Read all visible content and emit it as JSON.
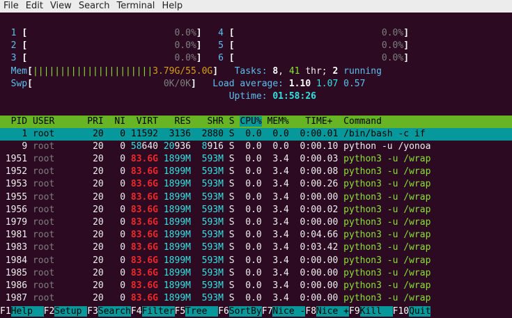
{
  "menu": [
    "File",
    "Edit",
    "View",
    "Search",
    "Terminal",
    "Help"
  ],
  "cpus": [
    {
      "num": "1",
      "value": "0.0%"
    },
    {
      "num": "2",
      "value": "0.0%"
    },
    {
      "num": "3",
      "value": "0.0%"
    },
    {
      "num": "4",
      "value": "0.0%"
    },
    {
      "num": "5",
      "value": "0.0%"
    },
    {
      "num": "6",
      "value": "0.0%"
    }
  ],
  "mem": {
    "label": "Mem",
    "bars": "||||||||||||||||||||||",
    "value": "3.79G/55.0G"
  },
  "swp": {
    "label": "Swp",
    "value": "0K/0K"
  },
  "tasks": {
    "label": "Tasks:",
    "count": "8",
    "thr": "41",
    "thr_label": "thr;",
    "running": "2",
    "running_label": "running"
  },
  "load": {
    "label": "Load average:",
    "v1": "1.10",
    "v2": "1.07",
    "v3": "0.57"
  },
  "uptime": {
    "label": "Uptime:",
    "value": "01:58:26"
  },
  "columns": {
    "pid": "PID",
    "user": "USER",
    "pri": "PRI",
    "ni": "NI",
    "virt": "VIRT",
    "res": "RES",
    "shr": "SHR",
    "s": "S",
    "cpu": "CPU%",
    "mem": "MEM%",
    "time": "TIME+",
    "command": "Command"
  },
  "processes": [
    {
      "pid": "1",
      "user": "root",
      "pri": "20",
      "ni": "0",
      "virt": "11592",
      "res": "3136",
      "shr": "2880",
      "s": "S",
      "cpu": "0.0",
      "mem": "0.0",
      "time": "0:00.01",
      "command": "/bin/bash -c if"
    },
    {
      "pid": "9",
      "user": "root",
      "pri": "20",
      "ni": "0",
      "virt_a": "58",
      "virt_b": "640",
      "res_a": "20",
      "res_b": "936",
      "shr_a": "8",
      "shr_b": "916",
      "s": "S",
      "cpu": "0.0",
      "mem": "0.0",
      "time": "0:00.10",
      "command": "python -u /yonoa"
    },
    {
      "pid": "1951",
      "user": "root",
      "pri": "20",
      "ni": "0",
      "virt": "83.6G",
      "res": "1899M",
      "shr": "593M",
      "s": "S",
      "cpu": "0.0",
      "mem": "3.4",
      "time": "0:00.03",
      "command": "python3 -u /wrap"
    },
    {
      "pid": "1952",
      "user": "root",
      "pri": "20",
      "ni": "0",
      "virt": "83.6G",
      "res": "1899M",
      "shr": "593M",
      "s": "S",
      "cpu": "0.0",
      "mem": "3.4",
      "time": "0:00.08",
      "command": "python3 -u /wrap"
    },
    {
      "pid": "1953",
      "user": "root",
      "pri": "20",
      "ni": "0",
      "virt": "83.6G",
      "res": "1899M",
      "shr": "593M",
      "s": "S",
      "cpu": "0.0",
      "mem": "3.4",
      "time": "0:00.26",
      "command": "python3 -u /wrap"
    },
    {
      "pid": "1955",
      "user": "root",
      "pri": "20",
      "ni": "0",
      "virt": "83.6G",
      "res": "1899M",
      "shr": "593M",
      "s": "S",
      "cpu": "0.0",
      "mem": "3.4",
      "time": "0:00.00",
      "command": "python3 -u /wrap"
    },
    {
      "pid": "1956",
      "user": "root",
      "pri": "20",
      "ni": "0",
      "virt": "83.6G",
      "res": "1899M",
      "shr": "593M",
      "s": "S",
      "cpu": "0.0",
      "mem": "3.4",
      "time": "0:00.02",
      "command": "python3 -u /wrap"
    },
    {
      "pid": "1979",
      "user": "root",
      "pri": "20",
      "ni": "0",
      "virt": "83.6G",
      "res": "1899M",
      "shr": "593M",
      "s": "S",
      "cpu": "0.0",
      "mem": "3.4",
      "time": "0:00.00",
      "command": "python3 -u /wrap"
    },
    {
      "pid": "1981",
      "user": "root",
      "pri": "20",
      "ni": "0",
      "virt": "83.6G",
      "res": "1899M",
      "shr": "593M",
      "s": "S",
      "cpu": "0.0",
      "mem": "3.4",
      "time": "0:04.66",
      "command": "python3 -u /wrap"
    },
    {
      "pid": "1983",
      "user": "root",
      "pri": "20",
      "ni": "0",
      "virt": "83.6G",
      "res": "1899M",
      "shr": "593M",
      "s": "S",
      "cpu": "0.0",
      "mem": "3.4",
      "time": "0:03.42",
      "command": "python3 -u /wrap"
    },
    {
      "pid": "1984",
      "user": "root",
      "pri": "20",
      "ni": "0",
      "virt": "83.6G",
      "res": "1899M",
      "shr": "593M",
      "s": "S",
      "cpu": "0.0",
      "mem": "3.4",
      "time": "0:00.00",
      "command": "python3 -u /wrap"
    },
    {
      "pid": "1985",
      "user": "root",
      "pri": "20",
      "ni": "0",
      "virt": "83.6G",
      "res": "1899M",
      "shr": "593M",
      "s": "S",
      "cpu": "0.0",
      "mem": "3.4",
      "time": "0:00.00",
      "command": "python3 -u /wrap"
    },
    {
      "pid": "1986",
      "user": "root",
      "pri": "20",
      "ni": "0",
      "virt": "83.6G",
      "res": "1899M",
      "shr": "593M",
      "s": "S",
      "cpu": "0.0",
      "mem": "3.4",
      "time": "0:00.00",
      "command": "python3 -u /wrap"
    },
    {
      "pid": "1987",
      "user": "root",
      "pri": "20",
      "ni": "0",
      "virt": "83.6G",
      "res": "1899M",
      "shr": "593M",
      "s": "S",
      "cpu": "0.0",
      "mem": "3.4",
      "time": "0:00.00",
      "command": "python3 -u /wrap"
    }
  ],
  "fkeys": [
    {
      "num": "F1",
      "label": "Help  "
    },
    {
      "num": "F2",
      "label": "Setup "
    },
    {
      "num": "F3",
      "label": "Search"
    },
    {
      "num": "F4",
      "label": "Filter"
    },
    {
      "num": "F5",
      "label": "Tree  "
    },
    {
      "num": "F6",
      "label": "SortBy"
    },
    {
      "num": "F7",
      "label": "Nice -"
    },
    {
      "num": "F8",
      "label": "Nice +"
    },
    {
      "num": "F9",
      "label": "Kill  "
    },
    {
      "num": "F10",
      "label": "Quit"
    }
  ],
  "colors": {
    "background": "#2b0a22",
    "header_bar": "#67b525",
    "selected_row": "#06989a",
    "meter_blue": "#5ec0f0",
    "green_text": "#8ae234",
    "red_text": "#ef2929"
  }
}
